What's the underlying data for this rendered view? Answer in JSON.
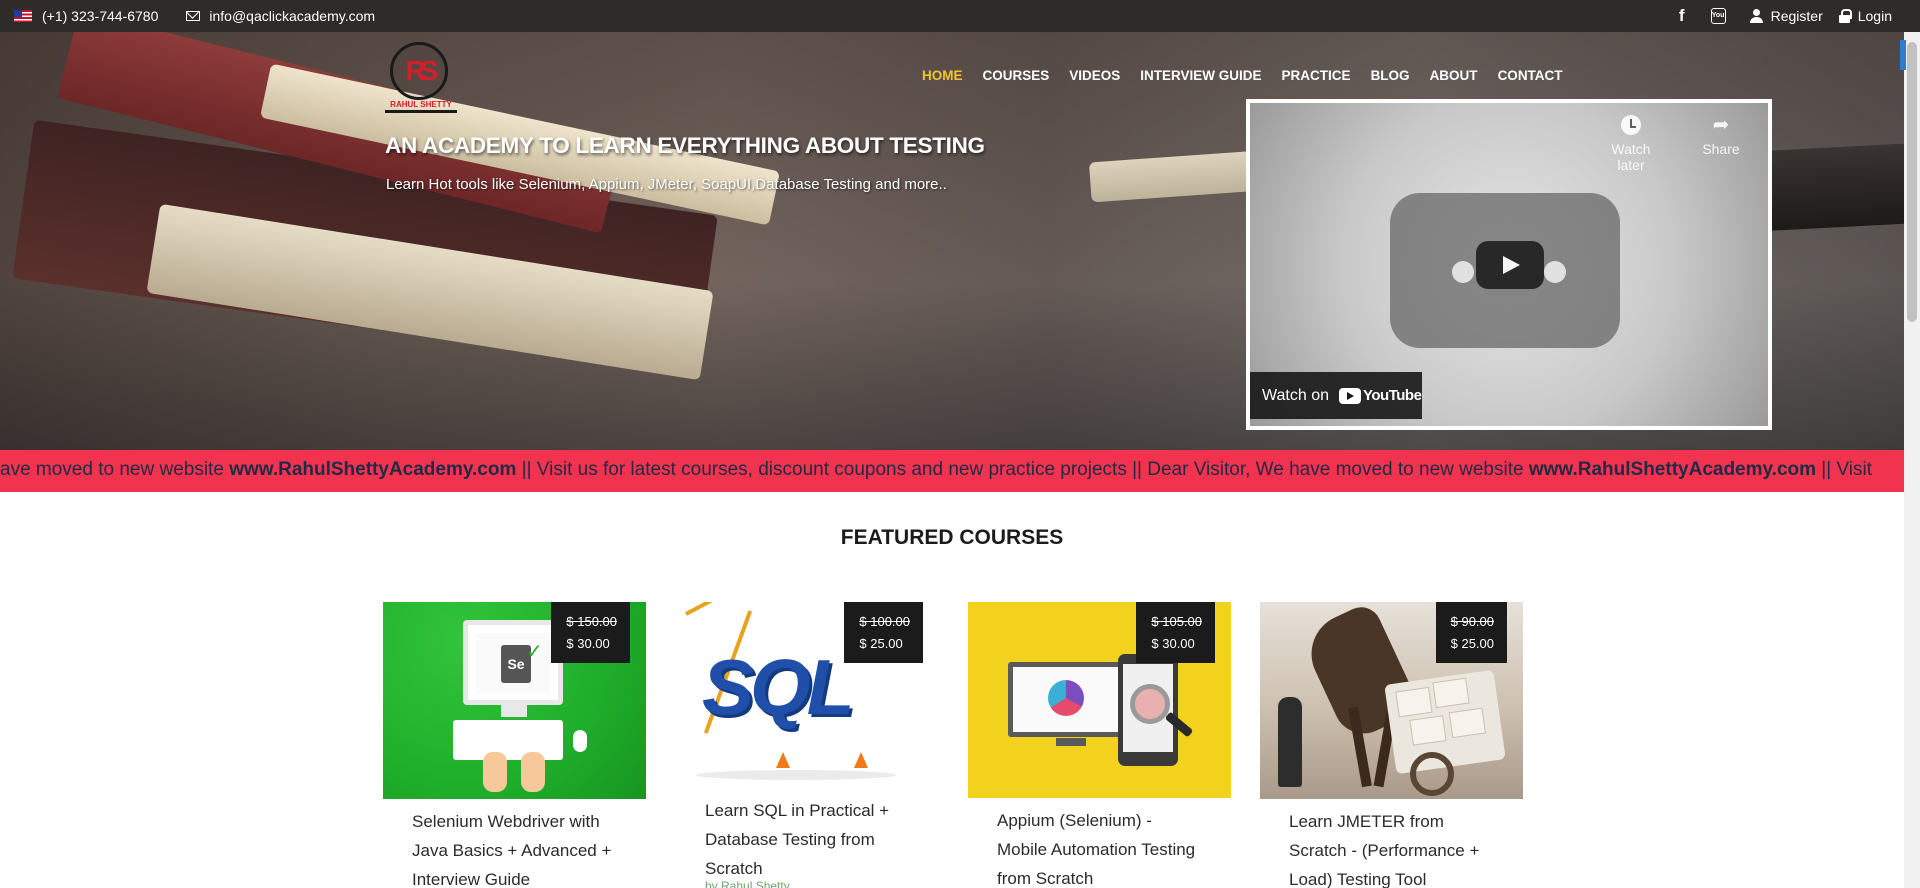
{
  "topbar": {
    "phone": "(+1) 323-744-6780",
    "email": "info@qaclickacademy.com",
    "register_label": "Register",
    "login_label": "Login"
  },
  "logo": {
    "mark": "RS",
    "text": "RAHUL SHETTY"
  },
  "nav": {
    "items": [
      {
        "label": "HOME",
        "active": true
      },
      {
        "label": "COURSES"
      },
      {
        "label": "VIDEOS"
      },
      {
        "label": "INTERVIEW GUIDE"
      },
      {
        "label": "PRACTICE"
      },
      {
        "label": "BLOG"
      },
      {
        "label": "ABOUT"
      },
      {
        "label": "CONTACT"
      }
    ]
  },
  "hero": {
    "title": "AN ACADEMY TO LEARN EVERYTHING ABOUT TESTING",
    "subtitle": "Learn Hot tools like Selenium, Appium, JMeter, SoapUI,Database Testing and more.."
  },
  "video": {
    "watch_later": "Watch later",
    "share": "Share",
    "watch_on": "Watch on",
    "youtube": "YouTube"
  },
  "marquee": {
    "seg1": "ave moved to new website ",
    "link1": "www.RahulShettyAcademy.com",
    "seg2": " || Visit us for latest courses, discount coupons and new practice projects || Dear Visitor, We have moved to new website ",
    "link2": "www.RahulShettyAcademy.com",
    "seg3": " || Visit"
  },
  "featured": {
    "title": "FEATURED COURSES",
    "courses": [
      {
        "title": "Selenium Webdriver with Java Basics + Advanced + Interview Guide",
        "old_price": "$ 150.00",
        "price": "$ 30.00",
        "image": "selenium"
      },
      {
        "title": "Learn SQL in Practical + Database Testing from Scratch",
        "old_price": "$ 100.00",
        "price": "$ 25.00",
        "author": "by Rahul Shetty",
        "image": "sql"
      },
      {
        "title": "Appium (Selenium) - Mobile Automation Testing from Scratch",
        "old_price": "$ 105.00",
        "price": "$ 30.00",
        "image": "appium"
      },
      {
        "title": "Learn JMETER from Scratch - (Performance + Load) Testing Tool",
        "old_price": "$ 90.00",
        "price": "$ 25.00",
        "image": "jmeter"
      }
    ]
  },
  "colors": {
    "topbar_bg": "#2f2b28",
    "nav_active": "#f4c430",
    "marquee_bg": "#f2334f",
    "marquee_text": "#1f2a44",
    "price_bg": "#1b1b1b"
  }
}
